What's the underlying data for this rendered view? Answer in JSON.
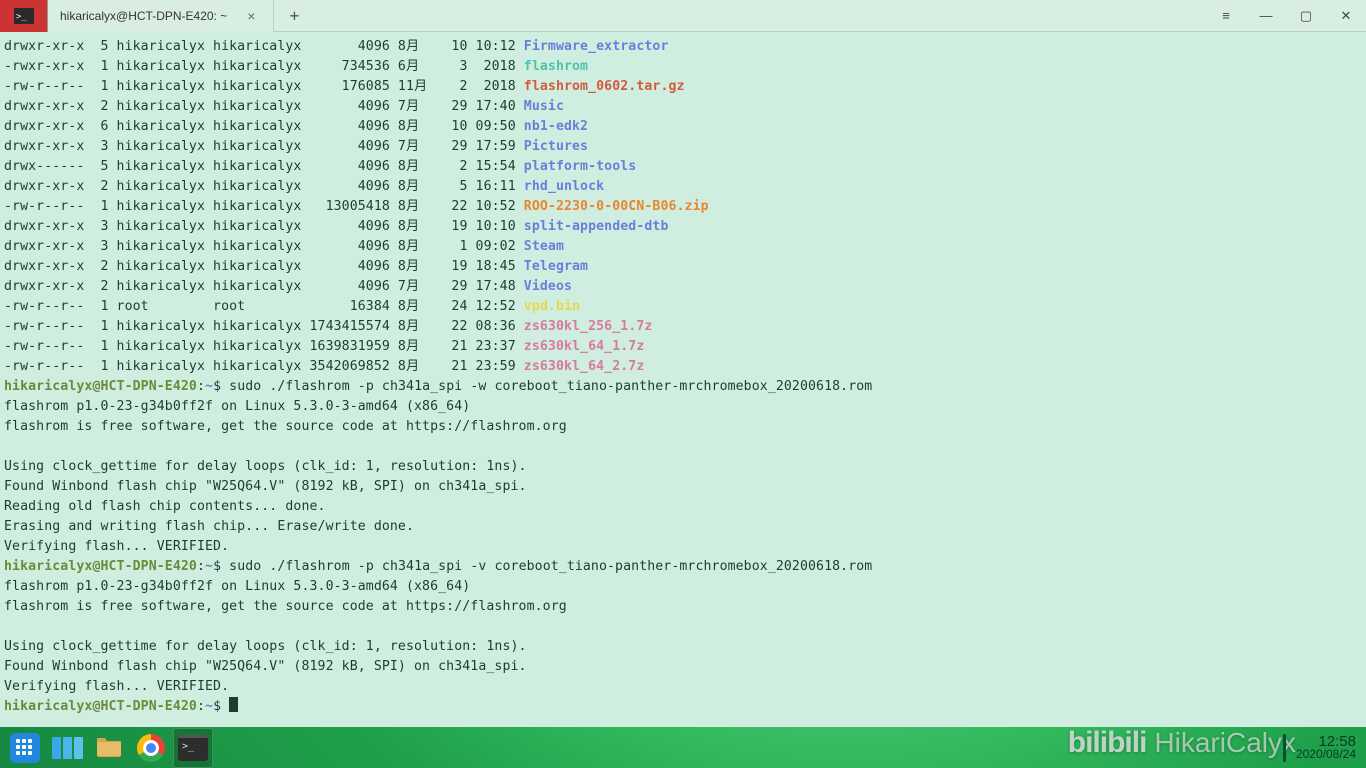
{
  "window": {
    "tab_title": "hikaricalyx@HCT-DPN-E420: ~",
    "new_tab": "+",
    "close": "×",
    "hamburger": "≡",
    "minimize": "—",
    "maximize": "▢",
    "win_close": "✕"
  },
  "prompt": {
    "user": "hikaricalyx",
    "at": "@",
    "host": "HCT-DPN-E420",
    "colon": ":",
    "path": "~",
    "dollar": "$"
  },
  "ls": [
    {
      "perm": "drwxr-xr-x",
      "n": "5",
      "u": "hikaricalyx",
      "g": "hikaricalyx",
      "size": "4096",
      "mon": "8月",
      "day": "10",
      "time": "10:12",
      "name": "Firmware_extractor",
      "cls": "c-dir"
    },
    {
      "perm": "-rwxr-xr-x",
      "n": "1",
      "u": "hikaricalyx",
      "g": "hikaricalyx",
      "size": "734536",
      "mon": "6月",
      "day": "3",
      "time": "2018",
      "name": "flashrom",
      "cls": "c-exec"
    },
    {
      "perm": "-rw-r--r--",
      "n": "1",
      "u": "hikaricalyx",
      "g": "hikaricalyx",
      "size": "176085",
      "mon": "11月",
      "day": "2",
      "time": "2018",
      "name": "flashrom_0602.tar.gz",
      "cls": "c-arch"
    },
    {
      "perm": "drwxr-xr-x",
      "n": "2",
      "u": "hikaricalyx",
      "g": "hikaricalyx",
      "size": "4096",
      "mon": "7月",
      "day": "29",
      "time": "17:40",
      "name": "Music",
      "cls": "c-dir"
    },
    {
      "perm": "drwxr-xr-x",
      "n": "6",
      "u": "hikaricalyx",
      "g": "hikaricalyx",
      "size": "4096",
      "mon": "8月",
      "day": "10",
      "time": "09:50",
      "name": "nb1-edk2",
      "cls": "c-dir"
    },
    {
      "perm": "drwxr-xr-x",
      "n": "3",
      "u": "hikaricalyx",
      "g": "hikaricalyx",
      "size": "4096",
      "mon": "7月",
      "day": "29",
      "time": "17:59",
      "name": "Pictures",
      "cls": "c-dir"
    },
    {
      "perm": "drwx------",
      "n": "5",
      "u": "hikaricalyx",
      "g": "hikaricalyx",
      "size": "4096",
      "mon": "8月",
      "day": "2",
      "time": "15:54",
      "name": "platform-tools",
      "cls": "c-dir"
    },
    {
      "perm": "drwxr-xr-x",
      "n": "2",
      "u": "hikaricalyx",
      "g": "hikaricalyx",
      "size": "4096",
      "mon": "8月",
      "day": "5",
      "time": "16:11",
      "name": "rhd_unlock",
      "cls": "c-dir"
    },
    {
      "perm": "-rw-r--r--",
      "n": "1",
      "u": "hikaricalyx",
      "g": "hikaricalyx",
      "size": "13005418",
      "mon": "8月",
      "day": "22",
      "time": "10:52",
      "name": "ROO-2230-0-00CN-B06.zip",
      "cls": "c-arch2"
    },
    {
      "perm": "drwxr-xr-x",
      "n": "3",
      "u": "hikaricalyx",
      "g": "hikaricalyx",
      "size": "4096",
      "mon": "8月",
      "day": "19",
      "time": "10:10",
      "name": "split-appended-dtb",
      "cls": "c-dir"
    },
    {
      "perm": "drwxr-xr-x",
      "n": "3",
      "u": "hikaricalyx",
      "g": "hikaricalyx",
      "size": "4096",
      "mon": "8月",
      "day": "1",
      "time": "09:02",
      "name": "Steam",
      "cls": "c-dir"
    },
    {
      "perm": "drwxr-xr-x",
      "n": "2",
      "u": "hikaricalyx",
      "g": "hikaricalyx",
      "size": "4096",
      "mon": "8月",
      "day": "19",
      "time": "18:45",
      "name": "Telegram",
      "cls": "c-dir"
    },
    {
      "perm": "drwxr-xr-x",
      "n": "2",
      "u": "hikaricalyx",
      "g": "hikaricalyx",
      "size": "4096",
      "mon": "7月",
      "day": "29",
      "time": "17:48",
      "name": "Videos",
      "cls": "c-dir"
    },
    {
      "perm": "-rw-r--r--",
      "n": "1",
      "u": "root",
      "g": "root",
      "size": "16384",
      "mon": "8月",
      "day": "24",
      "time": "12:52",
      "name": "vpd.bin",
      "cls": "c-yellow"
    },
    {
      "perm": "-rw-r--r--",
      "n": "1",
      "u": "hikaricalyx",
      "g": "hikaricalyx",
      "size": "1743415574",
      "mon": "8月",
      "day": "22",
      "time": "08:36",
      "name": "zs630kl_256_1.7z",
      "cls": "c-pink"
    },
    {
      "perm": "-rw-r--r--",
      "n": "1",
      "u": "hikaricalyx",
      "g": "hikaricalyx",
      "size": "1639831959",
      "mon": "8月",
      "day": "21",
      "time": "23:37",
      "name": "zs630kl_64_1.7z",
      "cls": "c-pink"
    },
    {
      "perm": "-rw-r--r--",
      "n": "1",
      "u": "hikaricalyx",
      "g": "hikaricalyx",
      "size": "3542069852",
      "mon": "8月",
      "day": "21",
      "time": "23:59",
      "name": "zs630kl_64_2.7z",
      "cls": "c-pink"
    }
  ],
  "commands": {
    "cmd1": "sudo ./flashrom -p ch341a_spi -w coreboot_tiano-panther-mrchromebox_20200618.rom",
    "cmd2": "sudo ./flashrom -p ch341a_spi -v coreboot_tiano-panther-mrchromebox_20200618.rom"
  },
  "output": {
    "o1": "flashrom p1.0-23-g34b0ff2f on Linux 5.3.0-3-amd64 (x86_64)",
    "o2": "flashrom is free software, get the source code at https://flashrom.org",
    "o3": "Using clock_gettime for delay loops (clk_id: 1, resolution: 1ns).",
    "o4": "Found Winbond flash chip \"W25Q64.V\" (8192 kB, SPI) on ch341a_spi.",
    "o5": "Reading old flash chip contents... done.",
    "o6": "Erasing and writing flash chip... Erase/write done.",
    "o7": "Verifying flash... VERIFIED."
  },
  "watermark": {
    "logo": "bilibili",
    "text": "HikariCalyx"
  },
  "clock": {
    "time": "12:58",
    "date": "2020/08/24"
  }
}
